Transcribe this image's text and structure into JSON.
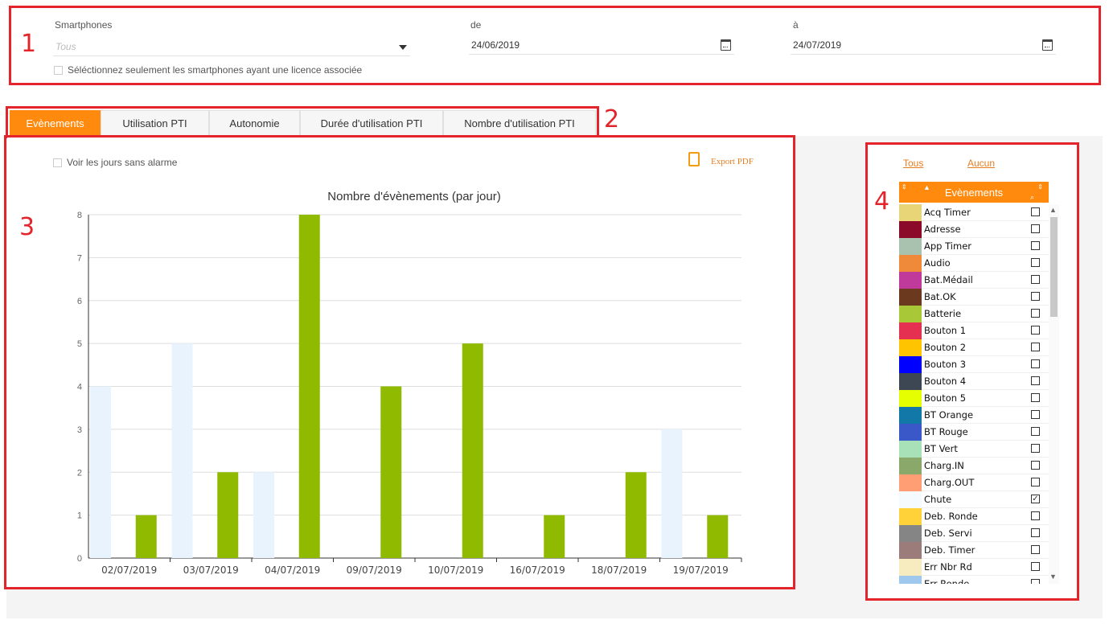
{
  "filters": {
    "smartphones_label": "Smartphones",
    "smartphones_placeholder": "Tous",
    "from_label": "de",
    "from_value": "24/06/2019",
    "to_label": "à",
    "to_value": "24/07/2019",
    "license_checkbox_label": "Séléctionnez seulement les smartphones ayant une licence associée"
  },
  "annotations": [
    "1",
    "2",
    "3",
    "4"
  ],
  "tabs": [
    {
      "label": "Evènements",
      "active": true
    },
    {
      "label": "Utilisation PTI",
      "active": false
    },
    {
      "label": "Autonomie",
      "active": false
    },
    {
      "label": "Durée d'utilisation PTI",
      "active": false
    },
    {
      "label": "Nombre d'utilisation PTI",
      "active": false
    }
  ],
  "chart_panel": {
    "show_days_label": "Voir les jours sans alarme",
    "export_label": "Export PDF"
  },
  "chart_data": {
    "type": "bar",
    "title": "Nombre d'évènements (par jour)",
    "categories": [
      "02/07/2019",
      "03/07/2019",
      "04/07/2019",
      "09/07/2019",
      "10/07/2019",
      "16/07/2019",
      "18/07/2019",
      "19/07/2019"
    ],
    "ylim": [
      0,
      8
    ],
    "yticks": [
      "0",
      "1",
      "2",
      "3",
      "4",
      "5",
      "6",
      "7",
      "8"
    ],
    "series": [
      {
        "color": "#e9f3fd",
        "values": [
          4,
          5,
          2,
          0,
          0,
          0,
          0,
          3
        ]
      },
      {
        "color": "#8fba00",
        "values": [
          1,
          2,
          8,
          4,
          5,
          1,
          2,
          1
        ]
      }
    ],
    "grid": true
  },
  "side_panel": {
    "all_label": "Tous",
    "none_label": "Aucun",
    "header_label": "Evènements",
    "items": [
      {
        "name": "Acq Timer",
        "color": "#e8d577",
        "checked": false
      },
      {
        "name": "Adresse",
        "color": "#8b0a2a",
        "checked": false
      },
      {
        "name": "App Timer",
        "color": "#a9c2b0",
        "checked": false
      },
      {
        "name": "Audio",
        "color": "#ee8a3a",
        "checked": false
      },
      {
        "name": "Bat.Médail",
        "color": "#c03a9c",
        "checked": false
      },
      {
        "name": "Bat.OK",
        "color": "#6b3a1e",
        "checked": false
      },
      {
        "name": "Batterie",
        "color": "#a8c838",
        "checked": false
      },
      {
        "name": "Bouton 1",
        "color": "#e63052",
        "checked": false
      },
      {
        "name": "Bouton 2",
        "color": "#ffc400",
        "checked": false
      },
      {
        "name": "Bouton 3",
        "color": "#0000ff",
        "checked": false
      },
      {
        "name": "Bouton 4",
        "color": "#3d4753",
        "checked": false
      },
      {
        "name": "Bouton 5",
        "color": "#e5ff00",
        "checked": false
      },
      {
        "name": "BT Orange",
        "color": "#1178a8",
        "checked": false
      },
      {
        "name": "BT Rouge",
        "color": "#3b58c8",
        "checked": false
      },
      {
        "name": "BT Vert",
        "color": "#a8e0b8",
        "checked": false
      },
      {
        "name": "Charg.IN",
        "color": "#8aa86a",
        "checked": false
      },
      {
        "name": "Charg.OUT",
        "color": "#ff9e75",
        "checked": false
      },
      {
        "name": "Chute",
        "color": "#f5faff",
        "checked": true
      },
      {
        "name": "Deb. Ronde",
        "color": "#ffd23a",
        "checked": false
      },
      {
        "name": "Deb. Servi",
        "color": "#858585",
        "checked": false
      },
      {
        "name": "Deb. Timer",
        "color": "#9c7b7b",
        "checked": false
      },
      {
        "name": "Err Nbr Rd",
        "color": "#f7ecc0",
        "checked": false
      },
      {
        "name": "Err Ronde",
        "color": "#9fc8ee",
        "checked": false
      }
    ]
  }
}
